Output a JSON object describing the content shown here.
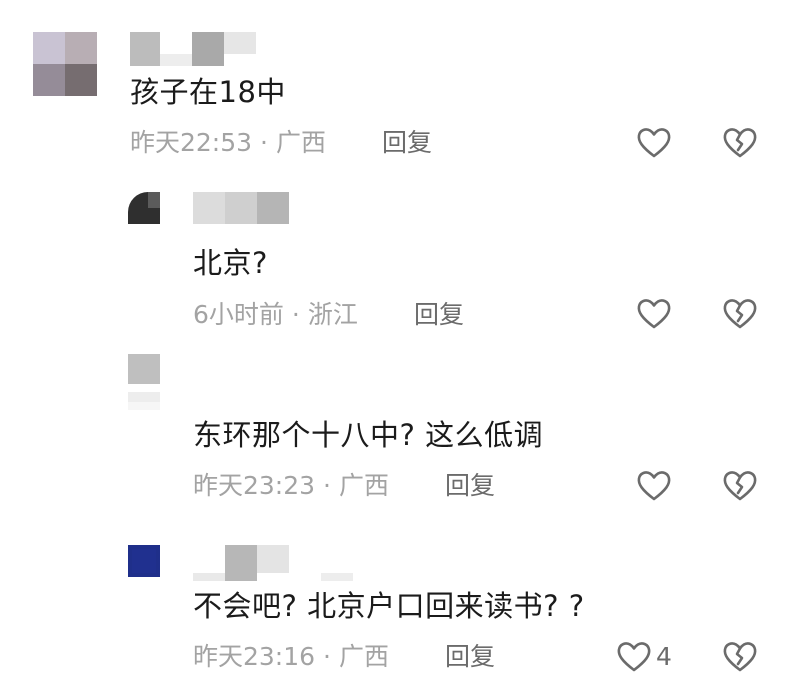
{
  "comments": [
    {
      "text": "孩子在18中",
      "time": "昨天22:53",
      "location": "广西",
      "reply_label": "回复",
      "like_icon": "heart-outline-icon",
      "dislike_icon": "broken-heart-icon"
    },
    {
      "text": "北京?",
      "time": "6小时前",
      "location": "浙江",
      "reply_label": "回复",
      "like_icon": "heart-outline-icon",
      "dislike_icon": "broken-heart-icon"
    },
    {
      "text": "东环那个十八中? 这么低调",
      "time": "昨天23:23",
      "location": "广西",
      "reply_label": "回复",
      "like_icon": "heart-outline-icon",
      "dislike_icon": "broken-heart-icon"
    },
    {
      "text": "不会吧? 北京户口回来读书? ?",
      "time": "昨天23:16",
      "location": "广西",
      "reply_label": "回复",
      "like_count": "4",
      "like_icon": "heart-outline-icon",
      "dislike_icon": "broken-heart-icon"
    }
  ],
  "separator": "·",
  "colors": {
    "text": "#1b1b1b",
    "meta": "#a3a3a3",
    "icon": "#6b6b6b",
    "reply_avatar_3": "#1f2f8a"
  }
}
